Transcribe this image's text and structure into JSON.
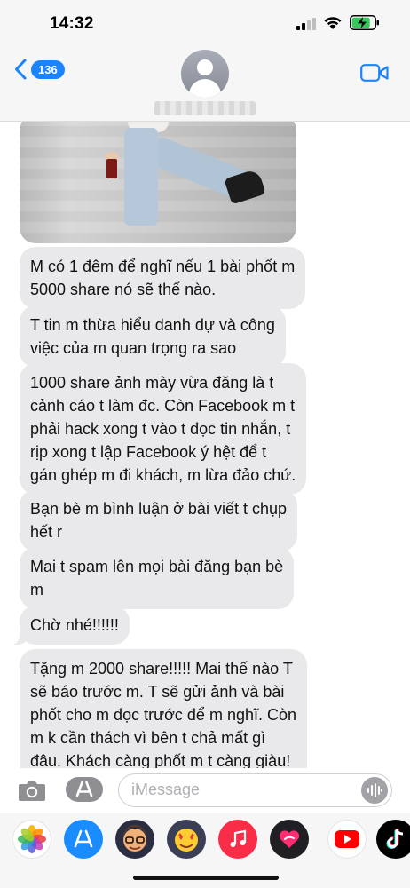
{
  "status": {
    "time": "14:32"
  },
  "header": {
    "badge_count": "136"
  },
  "messages": [
    {
      "text": "M có 1 đêm để nghĩ nếu 1 bài phốt m\n5000 share nó sẽ thế nào."
    },
    {
      "text": "T tin m thừa hiểu danh dự và công\nviệc của m quan trọng ra sao"
    },
    {
      "text": "1000 share ảnh mày vừa đăng là t\ncảnh cáo t làm đc. Còn Facebook m t\nphải hack xong t vào t đọc tin nhắn, t\nrịp xong t lập Facebook ý hệt để t\ngán ghép m đi khách, m lừa đảo chứ."
    },
    {
      "text": "Bạn bè m bình luận ở bài viết t chụp\nhết r"
    },
    {
      "text": "Mai t spam lên mọi bài đăng bạn bè\nm"
    },
    {
      "text": "Chờ nhé!!!!!!"
    },
    {
      "text": "Tặng m 2000 share!!!!! Mai thế nào T\nsẽ báo trước m. T sẽ gửi ảnh và bài\nphốt cho m đọc trước để m nghĩ. Còn\nm k cần thách vì bên t chả mất gì\nđâu. Khách càng phốt m t càng giàu!"
    }
  ],
  "composer": {
    "placeholder": "iMessage"
  },
  "app_drawer": {
    "apps": [
      "photos-icon",
      "app-store-icon",
      "memoji-icon",
      "animoji-icon",
      "music-icon",
      "digital-touch-icon",
      "youtube-icon",
      "tiktok-icon"
    ]
  },
  "colors": {
    "accent": "#1a84ff",
    "bubble_received": "#e9e9eb",
    "battery_charging": "#34c759"
  }
}
